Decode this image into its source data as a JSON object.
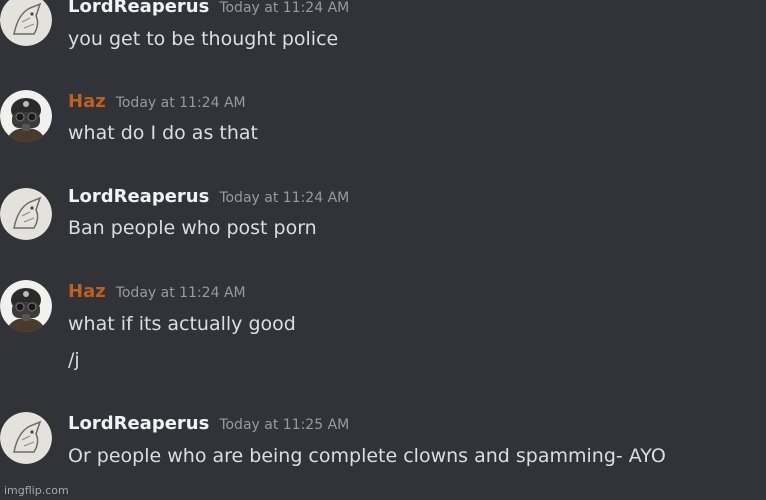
{
  "messages": [
    {
      "author": "LordReaperus",
      "timestamp": "Today at 11:24 AM",
      "lines": [
        "you get to be thought police"
      ],
      "avatar_icon": "sketch-creature-avatar"
    },
    {
      "author": "Haz",
      "author_color": "#c15f1d",
      "timestamp": "Today at 11:24 AM",
      "lines": [
        "what do I do as that"
      ],
      "avatar_icon": "gas-mask-soldier-avatar"
    },
    {
      "author": "LordReaperus",
      "timestamp": "Today at 11:24 AM",
      "lines": [
        "Ban people who post porn"
      ],
      "avatar_icon": "sketch-creature-avatar"
    },
    {
      "author": "Haz",
      "author_color": "#c15f1d",
      "timestamp": "Today at 11:24 AM",
      "lines": [
        "what if its actually good",
        "/j"
      ],
      "avatar_icon": "gas-mask-soldier-avatar"
    },
    {
      "author": "LordReaperus",
      "timestamp": "Today at 11:25 AM",
      "lines": [
        "Or people who are being complete clowns and spamming- AYO"
      ],
      "avatar_icon": "sketch-creature-avatar"
    }
  ],
  "watermark": "imgflip.com",
  "colors": {
    "background": "#313338",
    "username_default": "#f2f3f5",
    "username_haz": "#c15f1d",
    "message_text": "#dbdee1",
    "timestamp": "#949ba4"
  }
}
